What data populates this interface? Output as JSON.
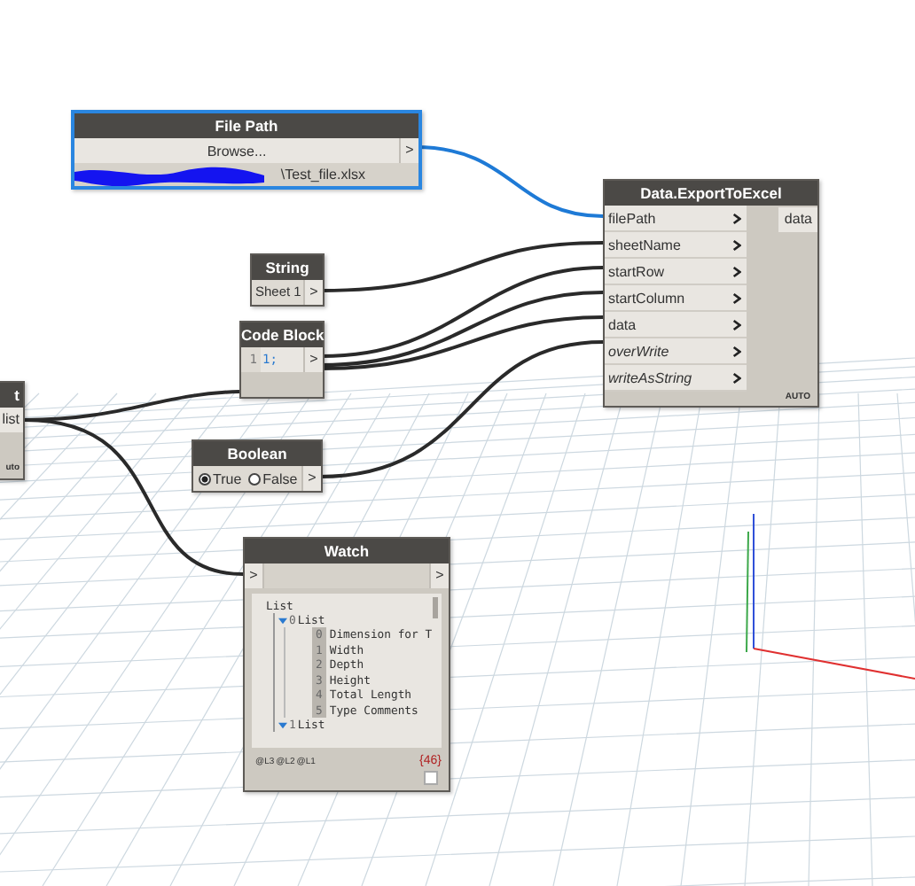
{
  "file_path_node": {
    "title": "File Path",
    "button": "Browse...",
    "output": ">",
    "value": "\\Test_file.xlsx",
    "redacted": true
  },
  "export_node": {
    "title": "Data.ExportToExcel",
    "inputs": [
      {
        "name": "filePath",
        "optional": false
      },
      {
        "name": "sheetName",
        "optional": false
      },
      {
        "name": "startRow",
        "optional": false
      },
      {
        "name": "startColumn",
        "optional": false
      },
      {
        "name": "data",
        "optional": false
      },
      {
        "name": "overWrite",
        "optional": true
      },
      {
        "name": "writeAsString",
        "optional": true
      }
    ],
    "outputs": [
      "data"
    ],
    "lacing": "AUTO"
  },
  "string_node": {
    "title": "String",
    "value": "Sheet 1",
    "output": ">"
  },
  "code_block_node": {
    "title": "Code Block",
    "line_number": "1",
    "code": "1;",
    "output": ">"
  },
  "partial_node": {
    "title": "t",
    "output": "list",
    "lacing": "uto"
  },
  "boolean_node": {
    "title": "Boolean",
    "options": [
      {
        "label": "True",
        "selected": true
      },
      {
        "label": "False",
        "selected": false
      }
    ],
    "output": ">"
  },
  "watch_node": {
    "title": "Watch",
    "input": ">",
    "output": ">",
    "tree": {
      "label": "List",
      "children": [
        {
          "index": "0",
          "label": "List",
          "expanded": true,
          "children": [
            {
              "index": "0",
              "label": "Dimension for T"
            },
            {
              "index": "1",
              "label": "Width"
            },
            {
              "index": "2",
              "label": "Depth"
            },
            {
              "index": "3",
              "label": "Height"
            },
            {
              "index": "4",
              "label": "Total Length"
            },
            {
              "index": "5",
              "label": "Type Comments"
            }
          ]
        },
        {
          "index": "1",
          "label": "List",
          "expanded": true
        }
      ]
    },
    "levels": [
      "@L3",
      "@L2",
      "@L1"
    ],
    "count": "{46}",
    "checked": false
  }
}
